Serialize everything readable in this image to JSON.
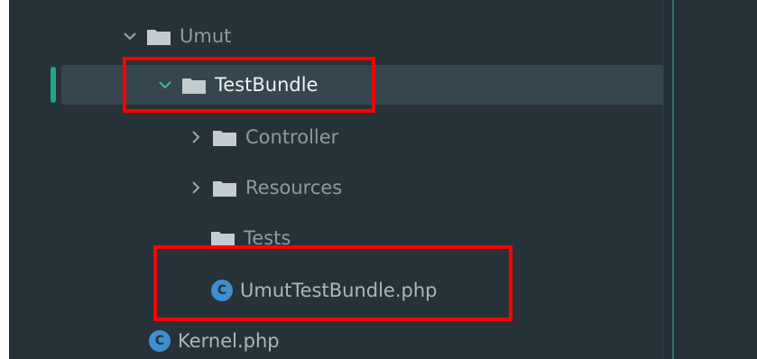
{
  "tree": {
    "items": [
      {
        "label": "Umut",
        "kind": "folder",
        "expanded": true,
        "icon": "chevron-down-icon"
      },
      {
        "label": "TestBundle",
        "kind": "folder",
        "expanded": true,
        "icon": "chevron-down-icon",
        "selected": true
      },
      {
        "label": "Controller",
        "kind": "folder",
        "expanded": false,
        "icon": "chevron-right-icon"
      },
      {
        "label": "Resources",
        "kind": "folder",
        "expanded": false,
        "icon": "chevron-right-icon"
      },
      {
        "label": "Tests",
        "kind": "folder"
      },
      {
        "label": "UmutTestBundle.php",
        "kind": "class-file"
      },
      {
        "label": "Kernel.php",
        "kind": "class-file"
      }
    ],
    "class_icon_letter": "C"
  },
  "colors": {
    "panel_bg": "#263238",
    "selection_bg": "#36464e",
    "accent": "#1fa58a",
    "class_icon": "#3e8ed0",
    "highlight": "#ff0000"
  }
}
